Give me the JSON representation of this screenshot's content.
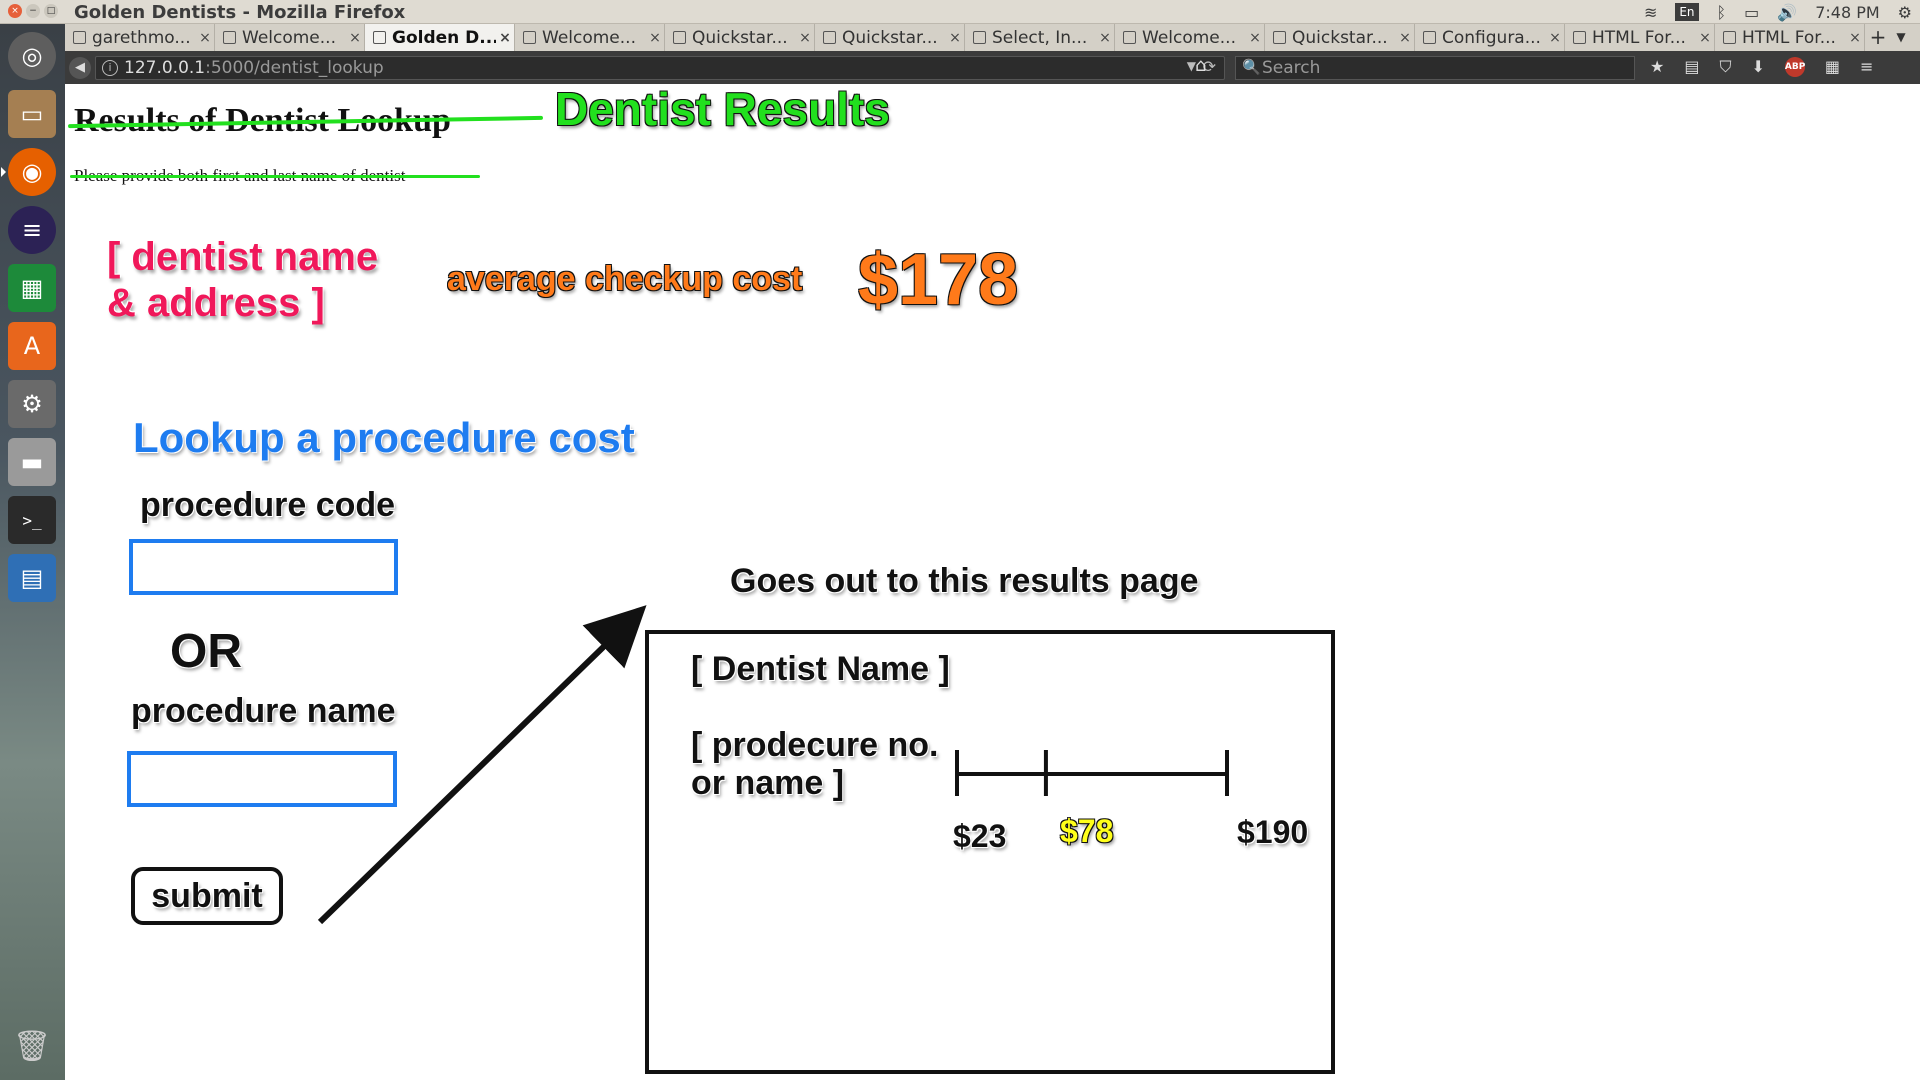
{
  "window": {
    "title": "Golden Dentists - Mozilla Firefox",
    "controls": {
      "close": "×",
      "minimize": "−",
      "maximize": "□"
    }
  },
  "system_tray": {
    "wifi": "≋",
    "keyboard_layout": "En",
    "bluetooth": "ᛒ",
    "battery": "▭",
    "volume": "🔊",
    "time": "7:48 PM",
    "settings": "⚙"
  },
  "tabs": [
    {
      "label": "garethmo...",
      "active": false
    },
    {
      "label": "Welcome...",
      "active": false
    },
    {
      "label": "Golden D...",
      "active": true
    },
    {
      "label": "Welcome...",
      "active": false
    },
    {
      "label": "Quickstar...",
      "active": false
    },
    {
      "label": "Quickstar...",
      "active": false
    },
    {
      "label": "Select, In...",
      "active": false
    },
    {
      "label": "Welcome...",
      "active": false
    },
    {
      "label": "Quickstar...",
      "active": false
    },
    {
      "label": "Configura...",
      "active": false
    },
    {
      "label": "HTML For...",
      "active": false
    },
    {
      "label": "HTML For...",
      "active": false
    }
  ],
  "tab_close_glyph": "×",
  "navbar": {
    "back": "◀",
    "info": "i",
    "url_host": "127.0.0.1",
    "url_path": ":5000/dentist_lookup",
    "dropdown": "▼",
    "reload": "⟳",
    "home": "⌂",
    "search_placeholder": "Search",
    "search_icon": "🔍",
    "bookmark": "★",
    "reading_list": "▤",
    "pocket": "⛉",
    "downloads": "⬇",
    "abp": "ABP",
    "extension": "▦",
    "menu": "≡"
  },
  "page": {
    "heading": "Results of Dentist Lookup",
    "annotation_title": "Dentist Results",
    "subtext": "Please provide both first and last name of dentist",
    "dentist_name_placeholder": "[ dentist name & address ]",
    "avg_cost_label": "average checkup cost",
    "avg_cost_value": "$178",
    "lookup_heading": "Lookup a procedure cost",
    "procedure_code_label": "procedure code",
    "procedure_code_value": "",
    "or_label": "OR",
    "procedure_name_label": "procedure name",
    "procedure_name_value": "",
    "submit_label": "submit",
    "results_caption": "Goes out to this results page"
  },
  "results_mockup": {
    "dentist_name": "[ Dentist Name ]",
    "procedure": "[ prodecure no. or name ]",
    "range": {
      "min": 23,
      "avg": 78,
      "max": 190,
      "min_label": "$23",
      "avg_label": "$78",
      "max_label": "$190"
    }
  },
  "colors": {
    "annotation_green": "#22e01e",
    "placeholder_pink": "#f0185a",
    "cost_orange": "#ff7a1a",
    "lookup_blue": "#1e7cf0",
    "avg_yellow": "#ffff1a"
  },
  "launcher": {
    "items": [
      "ubuntu-icon",
      "files-icon",
      "firefox-icon",
      "eclipse-icon",
      "spreadsheet-icon",
      "software-center-icon",
      "settings-icon",
      "disk-icon",
      "terminal-icon",
      "writer-icon",
      "trash-icon"
    ],
    "terminal_glyph": ">_"
  }
}
